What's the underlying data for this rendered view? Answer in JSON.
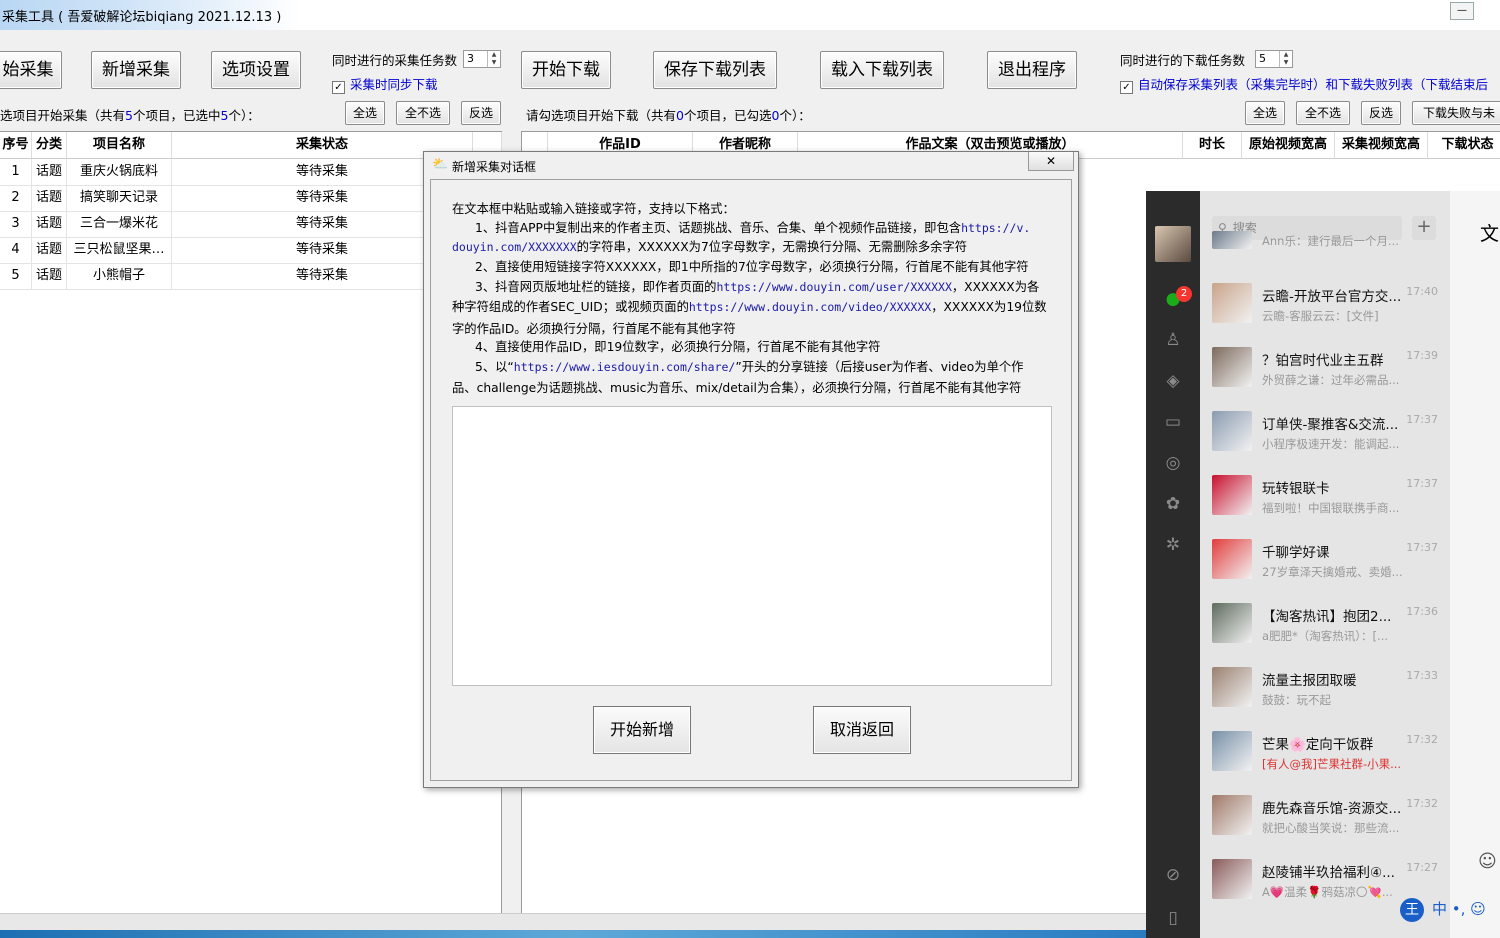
{
  "window": {
    "title": "采集工具 ( 吾爱破解论坛biqiang 2021.12.13 )",
    "min_label": "—"
  },
  "toolbar": {
    "start_collect": "始采集",
    "add_collect": "新增采集",
    "options": "选项设置",
    "collect_tasks_label": "同时进行的采集任务数",
    "collect_tasks_value": "3",
    "sync_download_label": "采集时同步下载",
    "start_download": "开始下载",
    "save_list": "保存下载列表",
    "load_list": "载入下载列表",
    "exit": "退出程序",
    "download_tasks_label": "同时进行的下载任务数",
    "download_tasks_value": "5",
    "autosave_label": "自动保存采集列表（采集完毕时）和下载失败列表（下载结束后"
  },
  "left_panel": {
    "info_prefix": "选项目开始采集（共有",
    "info_total": "5",
    "info_mid": "个项目，已选中",
    "info_selected": "5",
    "info_suffix": "个）：",
    "select_all": "全选",
    "select_none": "全不选",
    "invert": "反选",
    "columns": [
      "序号",
      "分类",
      "项目名称",
      "采集状态"
    ],
    "rows": [
      {
        "no": "1",
        "cat": "话题",
        "name": "重庆火锅底料",
        "status": "等待采集"
      },
      {
        "no": "2",
        "cat": "话题",
        "name": "搞笑聊天记录",
        "status": "等待采集"
      },
      {
        "no": "3",
        "cat": "话题",
        "name": "三合一爆米花",
        "status": "等待采集"
      },
      {
        "no": "4",
        "cat": "话题",
        "name": "三只松鼠坚果…",
        "status": "等待采集"
      },
      {
        "no": "5",
        "cat": "话题",
        "name": "小熊帽子",
        "status": "等待采集"
      }
    ]
  },
  "right_panel": {
    "info_prefix": "请勾选项目开始下载（共有",
    "info_total": "0",
    "info_mid": "个项目，已勾选",
    "info_selected": "0",
    "info_suffix": "个）：",
    "select_all": "全选",
    "select_none": "全不选",
    "invert": "反选",
    "failed_btn": "下载失败与未",
    "columns": [
      "作品ID",
      "作者昵称",
      "作品文案（双击预览或播放）",
      "时长",
      "原始视频宽高",
      "采集视频宽高",
      "下载状态"
    ]
  },
  "dialog": {
    "title": "新增采集对话框",
    "close": "✕",
    "intro": "在文本框中粘贴或输入链接或字符，支持以下格式：",
    "l1a": "1、抖音APP中复制出来的作者主页、话题挑战、音乐、合集、单个视频作品链接，即包含",
    "l1link": "https://v.",
    "l1b_link": "douyin.com/XXXXXXX",
    "l1b": "的字符串，XXXXXX为7位字母数字，无需换行分隔、无需删除多余字符",
    "l2": "2、直接使用短链接字符XXXXXX，即1中所指的7位字母数字，必须换行分隔，行首尾不能有其他字符",
    "l3a": "3、抖音网页版地址栏的链接，即作者页面的",
    "l3link": "https://www.douyin.com/user/XXXXXX",
    "l3a2": "，XXXXXX为各",
    "l3b": "种字符组成的作者SEC_UID；或视频页面的",
    "l3blink": "https://www.douyin.com/video/XXXXXX",
    "l3b2": "，XXXXXX为19位数",
    "l3c": "字的作品ID。必须换行分隔，行首尾不能有其他字符",
    "l4": "4、直接使用作品ID，即19位数字，必须换行分隔，行首尾不能有其他字符",
    "l5a": "5、以“",
    "l5link": "https://www.iesdouyin.com/share/",
    "l5a2": "”开头的分享链接（后接user为作者、video为单个作",
    "l5b": "品、challenge为话题挑战、music为音乐、mix/detail为合集），必须换行分隔，行首尾不能有其他字符",
    "ok": "开始新增",
    "cancel": "取消返回"
  },
  "wechat": {
    "search_placeholder": "搜索",
    "plus": "+",
    "badge": "2",
    "main_text": "文",
    "chats": [
      {
        "name": "",
        "time": "",
        "msg": "Ann乐：建行最后一个月...",
        "avatar_color": "#6b7a8c"
      },
      {
        "name": "云瞻-开放平台官方交...",
        "time": "17:40",
        "msg": "云瞻-客服云云：[文件]",
        "avatar_color": "#c9a38a"
      },
      {
        "name": "？铂宫时代业主五群",
        "time": "17:39",
        "msg": "外贸薛之谦：过年必需品...",
        "avatar_color": "#7d6a5c"
      },
      {
        "name": "订单侠-聚推客&交流...",
        "time": "17:37",
        "msg": "小程序极速开发：能调起...",
        "avatar_color": "#8a9bb0"
      },
      {
        "name": "玩转银联卡",
        "time": "17:37",
        "msg": "福到啦！中国银联携手商...",
        "avatar_color": "#c8102e"
      },
      {
        "name": "千聊学好课",
        "time": "17:37",
        "msg": "27岁章泽天擒婚戒、卖婚...",
        "avatar_color": "#e23c3c"
      },
      {
        "name": "【淘客热讯】抱团2...",
        "time": "17:36",
        "msg": "a肥肥*（淘客热讯）：[...",
        "avatar_color": "#5e6b5e"
      },
      {
        "name": "流量主报团取暖",
        "time": "17:33",
        "msg": "鼓鼓：玩不起",
        "avatar_color": "#9a8070"
      },
      {
        "name": "芒果🌸定向干饭群",
        "time": "17:32",
        "msg": "[有人@我]芒果社群-小果...",
        "avatar_color": "#7890a8"
      },
      {
        "name": "鹿先森音乐馆-资源交...",
        "time": "17:32",
        "msg": "就把心酸当笑说：那些流...",
        "avatar_color": "#a07868"
      },
      {
        "name": "赵陵铺半玖拾福利④...",
        "time": "17:27",
        "msg": "A💗温柔🌹鸦菇凉〇💘...",
        "avatar_color": "#8a5a5a"
      }
    ]
  },
  "ime": {
    "label": "中 •, ☺"
  }
}
